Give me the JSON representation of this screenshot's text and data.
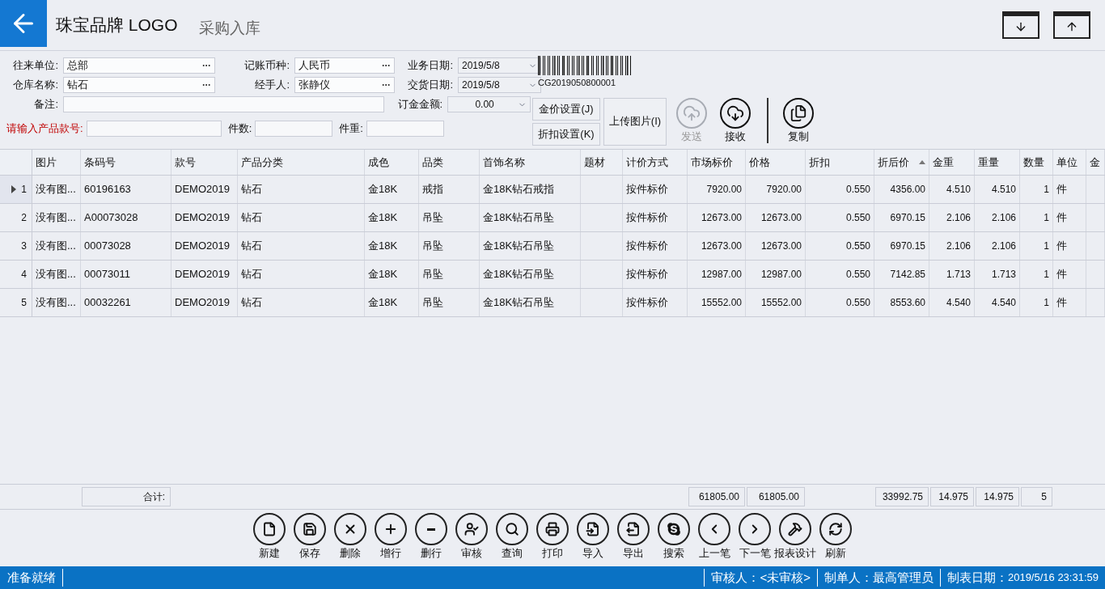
{
  "header": {
    "brand": "珠宝品牌 LOGO",
    "title": "采购入库"
  },
  "form": {
    "rows": [
      [
        {
          "label": "往来单位:",
          "value": "总部",
          "kind": "lookup"
        },
        {
          "label": "记账币种:",
          "value": "人民币",
          "kind": "lookup"
        },
        {
          "label": "业务日期:",
          "value": "2019/5/8",
          "kind": "dropdown"
        }
      ],
      [
        {
          "label": "仓库名称:",
          "value": "钻石",
          "kind": "lookup"
        },
        {
          "label": "经手人:",
          "value": "张静仪",
          "kind": "lookup"
        },
        {
          "label": "交货日期:",
          "value": "2019/5/8",
          "kind": "dropdown"
        }
      ]
    ],
    "note": {
      "label": "备注:"
    },
    "deposit": {
      "label": "订金金额:",
      "value": "0.00"
    },
    "entry": [
      {
        "label": "请输入产品款号:",
        "kind": "required"
      },
      {
        "label": "件数:",
        "kind": "plain"
      },
      {
        "label": "件重:",
        "kind": "plain"
      }
    ]
  },
  "barcode": "CG2019050800001",
  "actions": [
    {
      "label": "金价设置(J)"
    },
    {
      "label": "折扣设置(K)"
    },
    {
      "label": "上传图片(I)"
    }
  ],
  "round_actions": [
    {
      "label": "发送",
      "disabled": true
    },
    {
      "label": "接收",
      "disabled": false
    },
    {
      "label": "复制",
      "disabled": false
    }
  ],
  "table": {
    "columns": [
      {
        "label": "图片",
        "kind": "text"
      },
      {
        "label": "条码号",
        "kind": "text",
        "total": "合计:"
      },
      {
        "label": "款号",
        "kind": "text"
      },
      {
        "label": "产品分类",
        "kind": "text"
      },
      {
        "label": "成色",
        "kind": "text"
      },
      {
        "label": "品类",
        "kind": "text"
      },
      {
        "label": "首饰名称",
        "kind": "text"
      },
      {
        "label": "题材",
        "kind": "text"
      },
      {
        "label": "计价方式",
        "kind": "text"
      },
      {
        "label": "市场标价",
        "kind": "number",
        "total": "61805.00"
      },
      {
        "label": "价格",
        "kind": "number",
        "total": "61805.00"
      },
      {
        "label": "折扣",
        "kind": "number"
      },
      {
        "label": "折后价",
        "kind": "number",
        "sorted": true,
        "total": "33992.75"
      },
      {
        "label": "金重",
        "kind": "number",
        "total": "14.975"
      },
      {
        "label": "重量",
        "kind": "number",
        "total": "14.975"
      },
      {
        "label": "数量",
        "kind": "number",
        "total": "5"
      },
      {
        "label": "单位",
        "kind": "text"
      },
      {
        "label": "金",
        "kind": "text"
      }
    ],
    "rows": [
      {
        "number": "1",
        "selected": true,
        "cells": [
          "没有图...",
          "60196163",
          "DEMO2019",
          "钻石",
          "金18K",
          "戒指",
          "金18K钻石戒指",
          "",
          "按件标价",
          "7920.00",
          "7920.00",
          "0.550",
          "4356.00",
          "4.510",
          "4.510",
          "1",
          "件",
          ""
        ]
      },
      {
        "number": "2",
        "selected": false,
        "cells": [
          "没有图...",
          "A00073028",
          "DEMO2019",
          "钻石",
          "金18K",
          "吊坠",
          "金18K钻石吊坠",
          "",
          "按件标价",
          "12673.00",
          "12673.00",
          "0.550",
          "6970.15",
          "2.106",
          "2.106",
          "1",
          "件",
          ""
        ]
      },
      {
        "number": "3",
        "selected": false,
        "cells": [
          "没有图...",
          "00073028",
          "DEMO2019",
          "钻石",
          "金18K",
          "吊坠",
          "金18K钻石吊坠",
          "",
          "按件标价",
          "12673.00",
          "12673.00",
          "0.550",
          "6970.15",
          "2.106",
          "2.106",
          "1",
          "件",
          ""
        ]
      },
      {
        "number": "4",
        "selected": false,
        "cells": [
          "没有图...",
          "00073011",
          "DEMO2019",
          "钻石",
          "金18K",
          "吊坠",
          "金18K钻石吊坠",
          "",
          "按件标价",
          "12987.00",
          "12987.00",
          "0.550",
          "7142.85",
          "1.713",
          "1.713",
          "1",
          "件",
          ""
        ]
      },
      {
        "number": "5",
        "selected": false,
        "cells": [
          "没有图...",
          "00032261",
          "DEMO2019",
          "钻石",
          "金18K",
          "吊坠",
          "金18K钻石吊坠",
          "",
          "按件标价",
          "15552.00",
          "15552.00",
          "0.550",
          "8553.60",
          "4.540",
          "4.540",
          "1",
          "件",
          ""
        ]
      }
    ]
  },
  "toolbar": [
    "新建",
    "保存",
    "删除",
    "增行",
    "删行",
    "审核",
    "查询",
    "打印",
    "导入",
    "导出",
    "搜索",
    "上一笔",
    "下一笔",
    "报表设计",
    "刷新"
  ],
  "status_bar": {
    "message": "准备就绪",
    "fields": [
      {
        "label": "审核人：",
        "value": "<未审核>"
      },
      {
        "label": "制单人：",
        "value": "最高管理员"
      },
      {
        "label": "制表日期：",
        "value": "2019/5/16 23:31:59"
      }
    ]
  }
}
